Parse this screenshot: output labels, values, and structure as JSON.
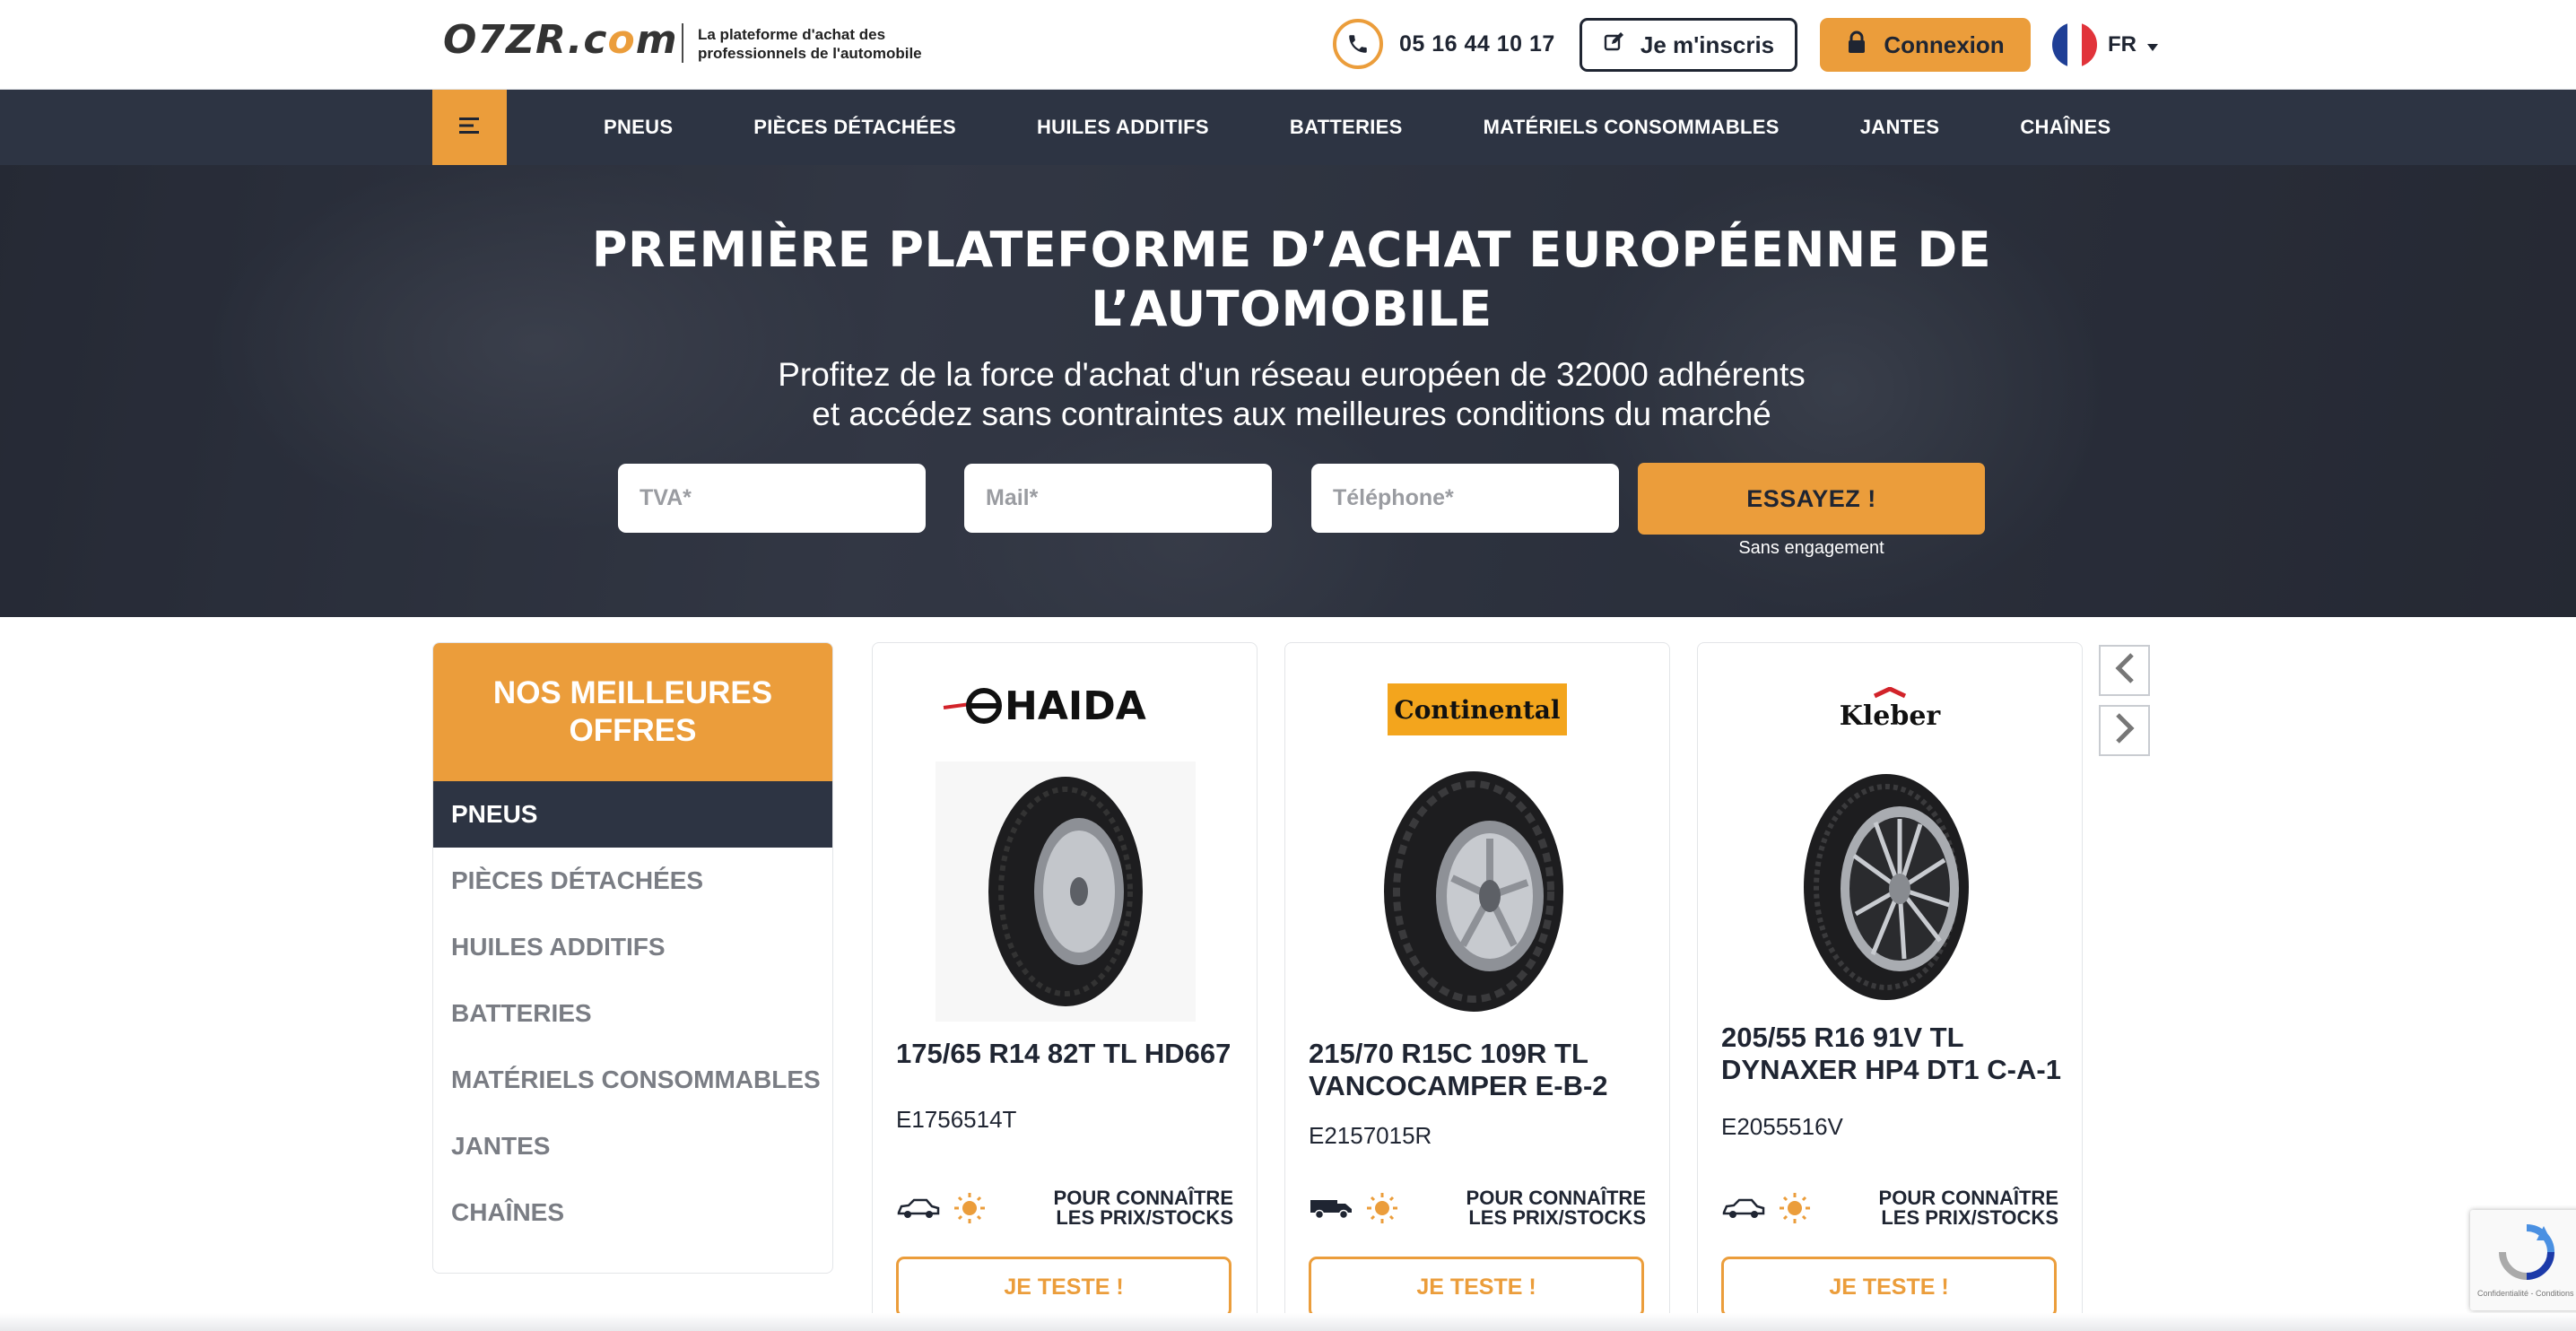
{
  "header": {
    "logo": "O7ZR.com",
    "tagline_line1": "La plateforme d'achat des",
    "tagline_line2": "professionnels de l'automobile",
    "phone": "05 16 44 10 17",
    "register_label": "Je m'inscris",
    "login_label": "Connexion",
    "language": "FR"
  },
  "nav": {
    "items": [
      "PNEUS",
      "PIÈCES DÉTACHÉES",
      "HUILES ADDITIFS",
      "BATTERIES",
      "MATÉRIELS CONSOMMABLES",
      "JANTES",
      "CHAÎNES"
    ]
  },
  "hero": {
    "title_line1": "PREMIÈRE PLATEFORME D’ACHAT EUROPÉENNE DE",
    "title_line2": "L’AUTOMOBILE",
    "subtitle_line1": "Profitez de la force d'achat d'un réseau européen de 32000 adhérents",
    "subtitle_line2": "et accédez sans contraintes aux meilleures conditions du marché",
    "tva_placeholder": "TVA*",
    "mail_placeholder": "Mail*",
    "phone_placeholder": "Téléphone*",
    "cta_label": "ESSAYEZ !",
    "cta_note": "Sans engagement"
  },
  "offers": {
    "title": "NOS MEILLEURES OFFRES",
    "categories": [
      "PNEUS",
      "PIÈCES DÉTACHÉES",
      "HUILES ADDITIFS",
      "BATTERIES",
      "MATÉRIELS CONSOMMABLES",
      "JANTES",
      "CHAÎNES"
    ],
    "active": "PNEUS"
  },
  "products": [
    {
      "brand": "HAIDA",
      "name_line1": "175/65 R14 82T TL HD667",
      "name_line2": "",
      "ref": "E1756514T",
      "price_line1": "POUR CONNAÎTRE",
      "price_line2": "LES PRIX/STOCKS",
      "button": "JE TESTE !",
      "vehicle_icon": "car-icon",
      "season_icon": "sun-icon"
    },
    {
      "brand": "Continental",
      "name_line1": "215/70 R15C 109R TL",
      "name_line2": "VANCOCAMPER E-B-2",
      "ref": "E2157015R",
      "price_line1": "POUR CONNAÎTRE",
      "price_line2": "LES PRIX/STOCKS",
      "button": "JE TESTE !",
      "vehicle_icon": "van-icon",
      "season_icon": "sun-icon"
    },
    {
      "brand": "Kleber",
      "name_line1": "205/55 R16 91V TL",
      "name_line2": "DYNAXER HP4 DT1 C-A-1",
      "ref": "E2055516V",
      "price_line1": "POUR CONNAÎTRE",
      "price_line2": "LES PRIX/STOCKS",
      "button": "JE TESTE !",
      "vehicle_icon": "car-icon",
      "season_icon": "sun-icon"
    }
  ],
  "recaptcha": {
    "text": "Confidentialité - Conditions"
  },
  "colors": {
    "accent": "#eb9d3b",
    "dark": "#2d3443",
    "text": "#1f2532"
  }
}
